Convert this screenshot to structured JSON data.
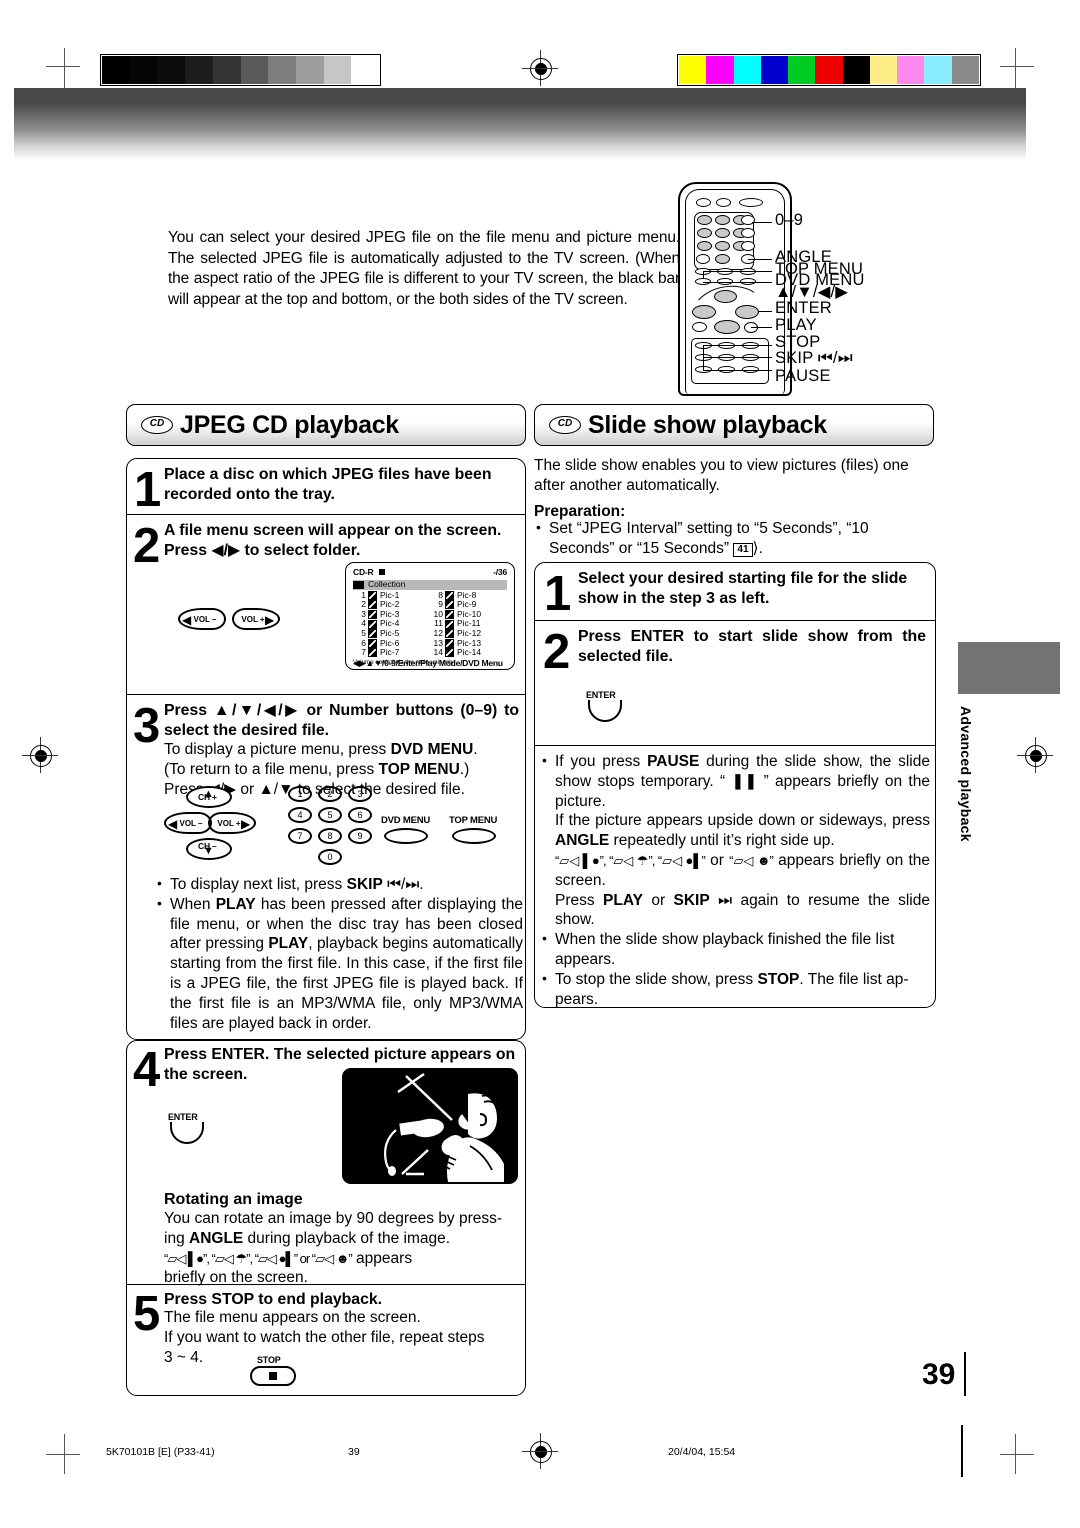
{
  "printer_marks": {
    "grayscale_bars": [
      "#000000",
      "#050505",
      "#0d0d0d",
      "#1c1c1c",
      "#333333",
      "#5a5a5a",
      "#7d7d7d",
      "#9d9d9d",
      "#c6c6c6",
      "#ffffff"
    ],
    "color_bars": [
      "#ffff00",
      "#ff00ff",
      "#00ffff",
      "#0000cc",
      "#00cc22",
      "#ee0000",
      "#000000",
      "#ffee88",
      "#ff88ee",
      "#88eeff",
      "#8a8a8a"
    ]
  },
  "intro": {
    "paragraph": "You can select your desired JPEG file on the file menu and picture menu. The selected JPEG file is automatically adjusted to the TV screen. (When the aspect ratio of the JPEG file is different to your TV screen, the black bar will appear at the top and bottom, or the both sides of the TV screen."
  },
  "remote": {
    "labels": [
      "0–9",
      "ANGLE",
      "TOP MENU",
      "DVD MENU",
      "▲/▼/◀/▶",
      "ENTER",
      "PLAY",
      "STOP",
      "SKIP ⏮/⏭",
      "PAUSE"
    ]
  },
  "left_column": {
    "header": {
      "badge": "CD",
      "title": "JPEG CD playback"
    },
    "steps": [
      {
        "num": "1",
        "title": "Place a disc on which JPEG files have been recorded onto the tray."
      },
      {
        "num": "2",
        "title": "A file menu screen will appear on the screen. Press ◀/▶ to select folder.",
        "keys": [
          "VOL –",
          "VOL +"
        ],
        "osd": {
          "disc": "CD-R",
          "counter": "-/36",
          "folder": "Collection",
          "left_items": [
            {
              "n": "1",
              "name": "Pic-1"
            },
            {
              "n": "2",
              "name": "Pic-2"
            },
            {
              "n": "3",
              "name": "Pic-3"
            },
            {
              "n": "4",
              "name": "Pic-4"
            },
            {
              "n": "5",
              "name": "Pic-5"
            },
            {
              "n": "6",
              "name": "Pic-6"
            },
            {
              "n": "7",
              "name": "Pic-7"
            }
          ],
          "right_items": [
            {
              "n": "8",
              "name": "Pic-8"
            },
            {
              "n": "9",
              "name": "Pic-9"
            },
            {
              "n": "10",
              "name": "Pic-10"
            },
            {
              "n": "11",
              "name": "Pic-11"
            },
            {
              "n": "12",
              "name": "Pic-12"
            },
            {
              "n": "13",
              "name": "Pic-13"
            },
            {
              "n": "14",
              "name": "Pic-14"
            }
          ],
          "footer": "◀▶▲▼/0-9/Enter/Play Mode/DVD Menu",
          "note": "Volume control via the main unit only"
        }
      },
      {
        "num": "3",
        "title": "Press ▲/▼/◀/▶ or Number buttons (0–9) to select the desired file.",
        "body_line1": "To display a picture menu, press ",
        "body_bold1": "DVD MENU",
        "body_line2": ". (To return to a file menu, press ",
        "body_bold2": "TOP MENU",
        "body_line3": ".) Press ◀/▶ or ▲/▼ to select the desired file.",
        "keys": {
          "ch_up": "CH +",
          "ch_down": "CH –",
          "vol_minus": "VOL –",
          "vol_plus": "VOL +",
          "numbers": [
            "1",
            "2",
            "3",
            "4",
            "5",
            "6",
            "7",
            "8",
            "9",
            "0"
          ],
          "dvd_menu": "DVD MENU",
          "top_menu": "TOP MENU"
        },
        "bullets": [
          "To display next list, press SKIP ⏮/⏭.",
          "When PLAY has been pressed after displaying the file menu, or when the disc tray has been closed after pressing PLAY, playback begins automatically starting from the first file. In this case, if the first file is a JPEG file, the first JPEG file is played back. If the first file is an MP3/WMA file, only MP3/WMA files are played back in order."
        ]
      },
      {
        "num": "4",
        "title": "Press ENTER. The selected picture appears on the screen.",
        "key_label": "ENTER",
        "subhead": "Rotating an image",
        "body": "You can rotate an image by 90 degrees by pressing ANGLE during playback of the image. “⊐◁▌●”, “⊐◁▼”, “⊐◁●▌” or “⊐◁☻” appears briefly on the screen."
      },
      {
        "num": "5",
        "title": "Press STOP to end playback.",
        "body": "The file menu appears on the screen. If you want to watch the other file, repeat steps 3 ~ 4.",
        "key_label": "STOP"
      }
    ]
  },
  "right_column": {
    "header": {
      "badge": "CD",
      "title": "Slide show playback"
    },
    "intro": "The slide show enables you to view pictures (files) one after another automatically.",
    "preparation_label": "Preparation:",
    "preparation_bullet": "Set “JPEG Interval” setting to “5 Seconds”, “10 Seconds” or “15 Seconds”",
    "preparation_ref": "41",
    "steps": [
      {
        "num": "1",
        "title": "Select your desired starting file for the slide show in the step 3 as left."
      },
      {
        "num": "2",
        "title": "Press ENTER to start slide show from the selected file.",
        "key_label": "ENTER"
      }
    ],
    "bullets": [
      "If you press PAUSE during the slide show, the slide show stops temporary. “ ❚❚ ” appears briefly on the picture. If the picture appears upside down or sideways, press ANGLE repeatedly until it’s right side up. “⊐◁▌●”, “⊐◁▼”, “⊐◁●▌” or “⊐◁☻” appears briefly on the screen. Press PLAY or SKIP ⏭ again to resume the slide show.",
      "When the slide show playback finished the file list appears.",
      "To stop the slide show, press STOP. The file list appears."
    ]
  },
  "side_tab": {
    "label": "Advanced playback"
  },
  "page_number": "39",
  "footer": {
    "left": "5K70101B [E] (P33-41)",
    "center": "39",
    "right": "20/4/04, 15:54"
  }
}
